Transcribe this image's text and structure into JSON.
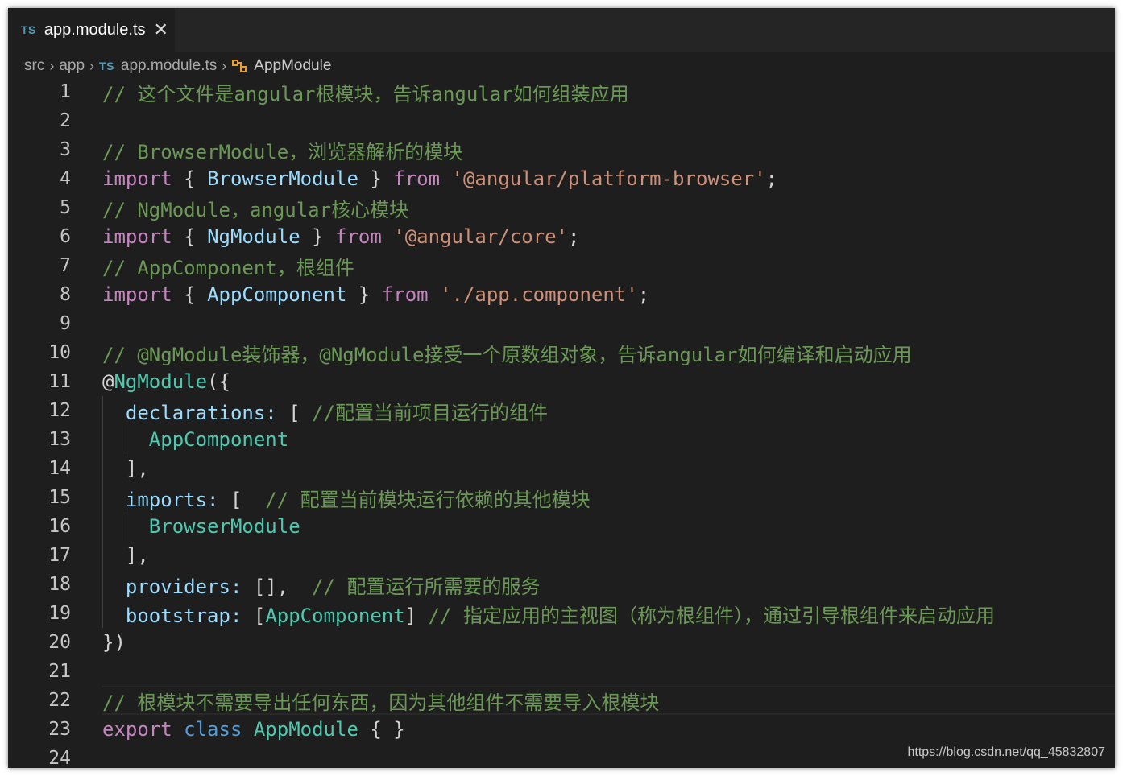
{
  "tab": {
    "badge": "TS",
    "title": "app.module.ts",
    "close": "✕"
  },
  "breadcrumb": {
    "items": [
      "src",
      "app",
      "app.module.ts",
      "AppModule"
    ],
    "file_badge": "TS"
  },
  "lines": [
    {
      "n": "1",
      "tokens": [
        {
          "c": "c",
          "t": "// 这个文件是angular根模块，告诉angular如何组装应用"
        }
      ]
    },
    {
      "n": "2",
      "tokens": []
    },
    {
      "n": "3",
      "tokens": [
        {
          "c": "c",
          "t": "// BrowserModule，浏览器解析的模块"
        }
      ]
    },
    {
      "n": "4",
      "tokens": [
        {
          "c": "k",
          "t": "import"
        },
        {
          "c": "p",
          "t": " { "
        },
        {
          "c": "v",
          "t": "BrowserModule"
        },
        {
          "c": "p",
          "t": " } "
        },
        {
          "c": "k",
          "t": "from"
        },
        {
          "c": "p",
          "t": " "
        },
        {
          "c": "s",
          "t": "'@angular/platform-browser'"
        },
        {
          "c": "p",
          "t": ";"
        }
      ]
    },
    {
      "n": "5",
      "tokens": [
        {
          "c": "c",
          "t": "// NgModule，angular核心模块"
        }
      ]
    },
    {
      "n": "6",
      "tokens": [
        {
          "c": "k",
          "t": "import"
        },
        {
          "c": "p",
          "t": " { "
        },
        {
          "c": "v",
          "t": "NgModule"
        },
        {
          "c": "p",
          "t": " } "
        },
        {
          "c": "k",
          "t": "from"
        },
        {
          "c": "p",
          "t": " "
        },
        {
          "c": "s",
          "t": "'@angular/core'"
        },
        {
          "c": "p",
          "t": ";"
        }
      ]
    },
    {
      "n": "7",
      "tokens": [
        {
          "c": "c",
          "t": "// AppComponent，根组件"
        }
      ]
    },
    {
      "n": "8",
      "tokens": [
        {
          "c": "k",
          "t": "import"
        },
        {
          "c": "p",
          "t": " { "
        },
        {
          "c": "v",
          "t": "AppComponent"
        },
        {
          "c": "p",
          "t": " } "
        },
        {
          "c": "k",
          "t": "from"
        },
        {
          "c": "p",
          "t": " "
        },
        {
          "c": "s",
          "t": "'./app.component'"
        },
        {
          "c": "p",
          "t": ";"
        }
      ]
    },
    {
      "n": "9",
      "tokens": []
    },
    {
      "n": "10",
      "tokens": [
        {
          "c": "c",
          "t": "// @NgModule装饰器，@NgModule接受一个原数组对象，告诉angular如何编译和启动应用"
        }
      ]
    },
    {
      "n": "11",
      "tokens": [
        {
          "c": "p",
          "t": "@"
        },
        {
          "c": "t",
          "t": "NgModule"
        },
        {
          "c": "p",
          "t": "({"
        }
      ]
    },
    {
      "n": "12",
      "tokens": [
        {
          "c": "p",
          "t": "  "
        },
        {
          "c": "v",
          "t": "declarations:"
        },
        {
          "c": "p",
          "t": " [ "
        },
        {
          "c": "c",
          "t": "//配置当前项目运行的组件"
        }
      ]
    },
    {
      "n": "13",
      "tokens": [
        {
          "c": "p",
          "t": "    "
        },
        {
          "c": "t",
          "t": "AppComponent"
        }
      ]
    },
    {
      "n": "14",
      "tokens": [
        {
          "c": "p",
          "t": "  ],"
        }
      ]
    },
    {
      "n": "15",
      "tokens": [
        {
          "c": "p",
          "t": "  "
        },
        {
          "c": "v",
          "t": "imports:"
        },
        {
          "c": "p",
          "t": " [  "
        },
        {
          "c": "c",
          "t": "// 配置当前模块运行依赖的其他模块"
        }
      ]
    },
    {
      "n": "16",
      "tokens": [
        {
          "c": "p",
          "t": "    "
        },
        {
          "c": "t",
          "t": "BrowserModule"
        }
      ]
    },
    {
      "n": "17",
      "tokens": [
        {
          "c": "p",
          "t": "  ],"
        }
      ]
    },
    {
      "n": "18",
      "tokens": [
        {
          "c": "p",
          "t": "  "
        },
        {
          "c": "v",
          "t": "providers:"
        },
        {
          "c": "p",
          "t": " [],  "
        },
        {
          "c": "c",
          "t": "// 配置运行所需要的服务"
        }
      ]
    },
    {
      "n": "19",
      "tokens": [
        {
          "c": "p",
          "t": "  "
        },
        {
          "c": "v",
          "t": "bootstrap:"
        },
        {
          "c": "p",
          "t": " ["
        },
        {
          "c": "t",
          "t": "AppComponent"
        },
        {
          "c": "p",
          "t": "] "
        },
        {
          "c": "c",
          "t": "// 指定应用的主视图（称为根组件），通过引导根组件来启动应用"
        }
      ]
    },
    {
      "n": "20",
      "tokens": [
        {
          "c": "p",
          "t": "})"
        }
      ]
    },
    {
      "n": "21",
      "tokens": []
    },
    {
      "n": "22",
      "tokens": [
        {
          "c": "c",
          "t": "// 根模块不需要导出任何东西，因为其他组件不需要导入根模块"
        }
      ]
    },
    {
      "n": "23",
      "tokens": [
        {
          "c": "k",
          "t": "export"
        },
        {
          "c": "p",
          "t": " "
        },
        {
          "c": "kb",
          "t": "class"
        },
        {
          "c": "p",
          "t": " "
        },
        {
          "c": "t",
          "t": "AppModule"
        },
        {
          "c": "p",
          "t": " { }"
        }
      ]
    },
    {
      "n": "24",
      "tokens": []
    }
  ],
  "watermark": "https://blog.csdn.net/qq_45832807",
  "colors": {
    "comment": "#6a9955",
    "keyword": "#c586c0",
    "storage": "#569cd6",
    "variable": "#9cdcfe",
    "type": "#4ec9b0",
    "string": "#ce9178",
    "ts_badge": "#519aba",
    "symbol_icon": "#ee9d28"
  },
  "icons": {
    "tab_close": "close-icon",
    "breadcrumb_sep": "chevron-right-icon",
    "symbol": "class-symbol-icon"
  }
}
